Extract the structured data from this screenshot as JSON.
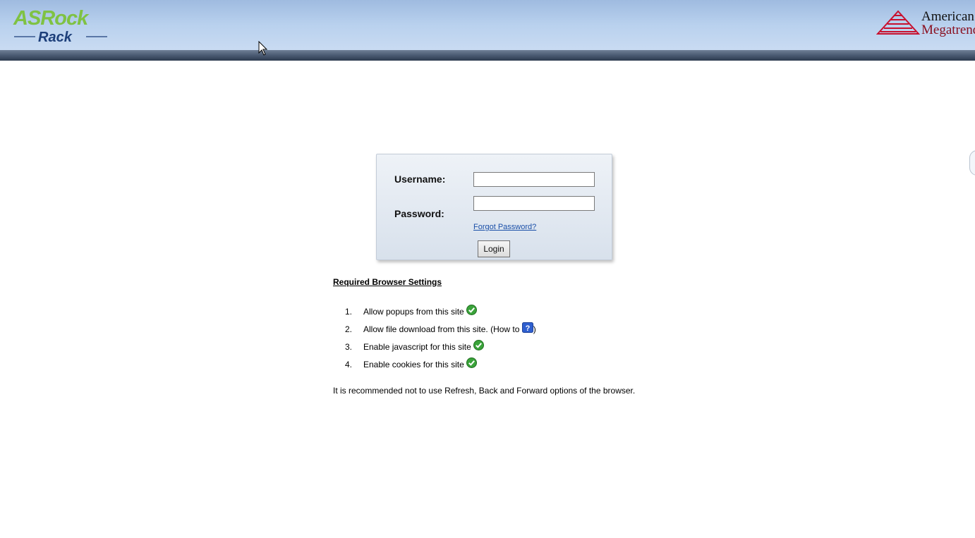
{
  "header": {
    "left_logo_text": "ASRock Rack",
    "right_logo_line1": "American",
    "right_logo_line2": "Megatrends",
    "colors": {
      "banner_top": "#9fbbe0",
      "banner_bottom": "#c9dbf2",
      "strip": "#3b4a61",
      "asrock_green": "#7fc243",
      "asrock_blue": "#1d3f7a",
      "ami_red": "#c8102e"
    }
  },
  "login": {
    "username_label": "Username:",
    "username_value": "",
    "password_label": "Password:",
    "password_value": "",
    "forgot_password": "Forgot Password?",
    "login_button": "Login"
  },
  "requirements": {
    "title": "Required Browser Settings",
    "items": [
      {
        "num": "1.",
        "text": "Allow popups from this site",
        "icon": "check-icon"
      },
      {
        "num": "2.",
        "text": "Allow file download from this site. (How to ",
        "suffix": ")",
        "icon": "help-icon"
      },
      {
        "num": "3.",
        "text": "Enable javascript for this site",
        "icon": "check-icon"
      },
      {
        "num": "4.",
        "text": "Enable cookies for this site",
        "icon": "check-icon"
      }
    ],
    "recommendation": "It is recommended not to use Refresh, Back and Forward options of the browser."
  }
}
